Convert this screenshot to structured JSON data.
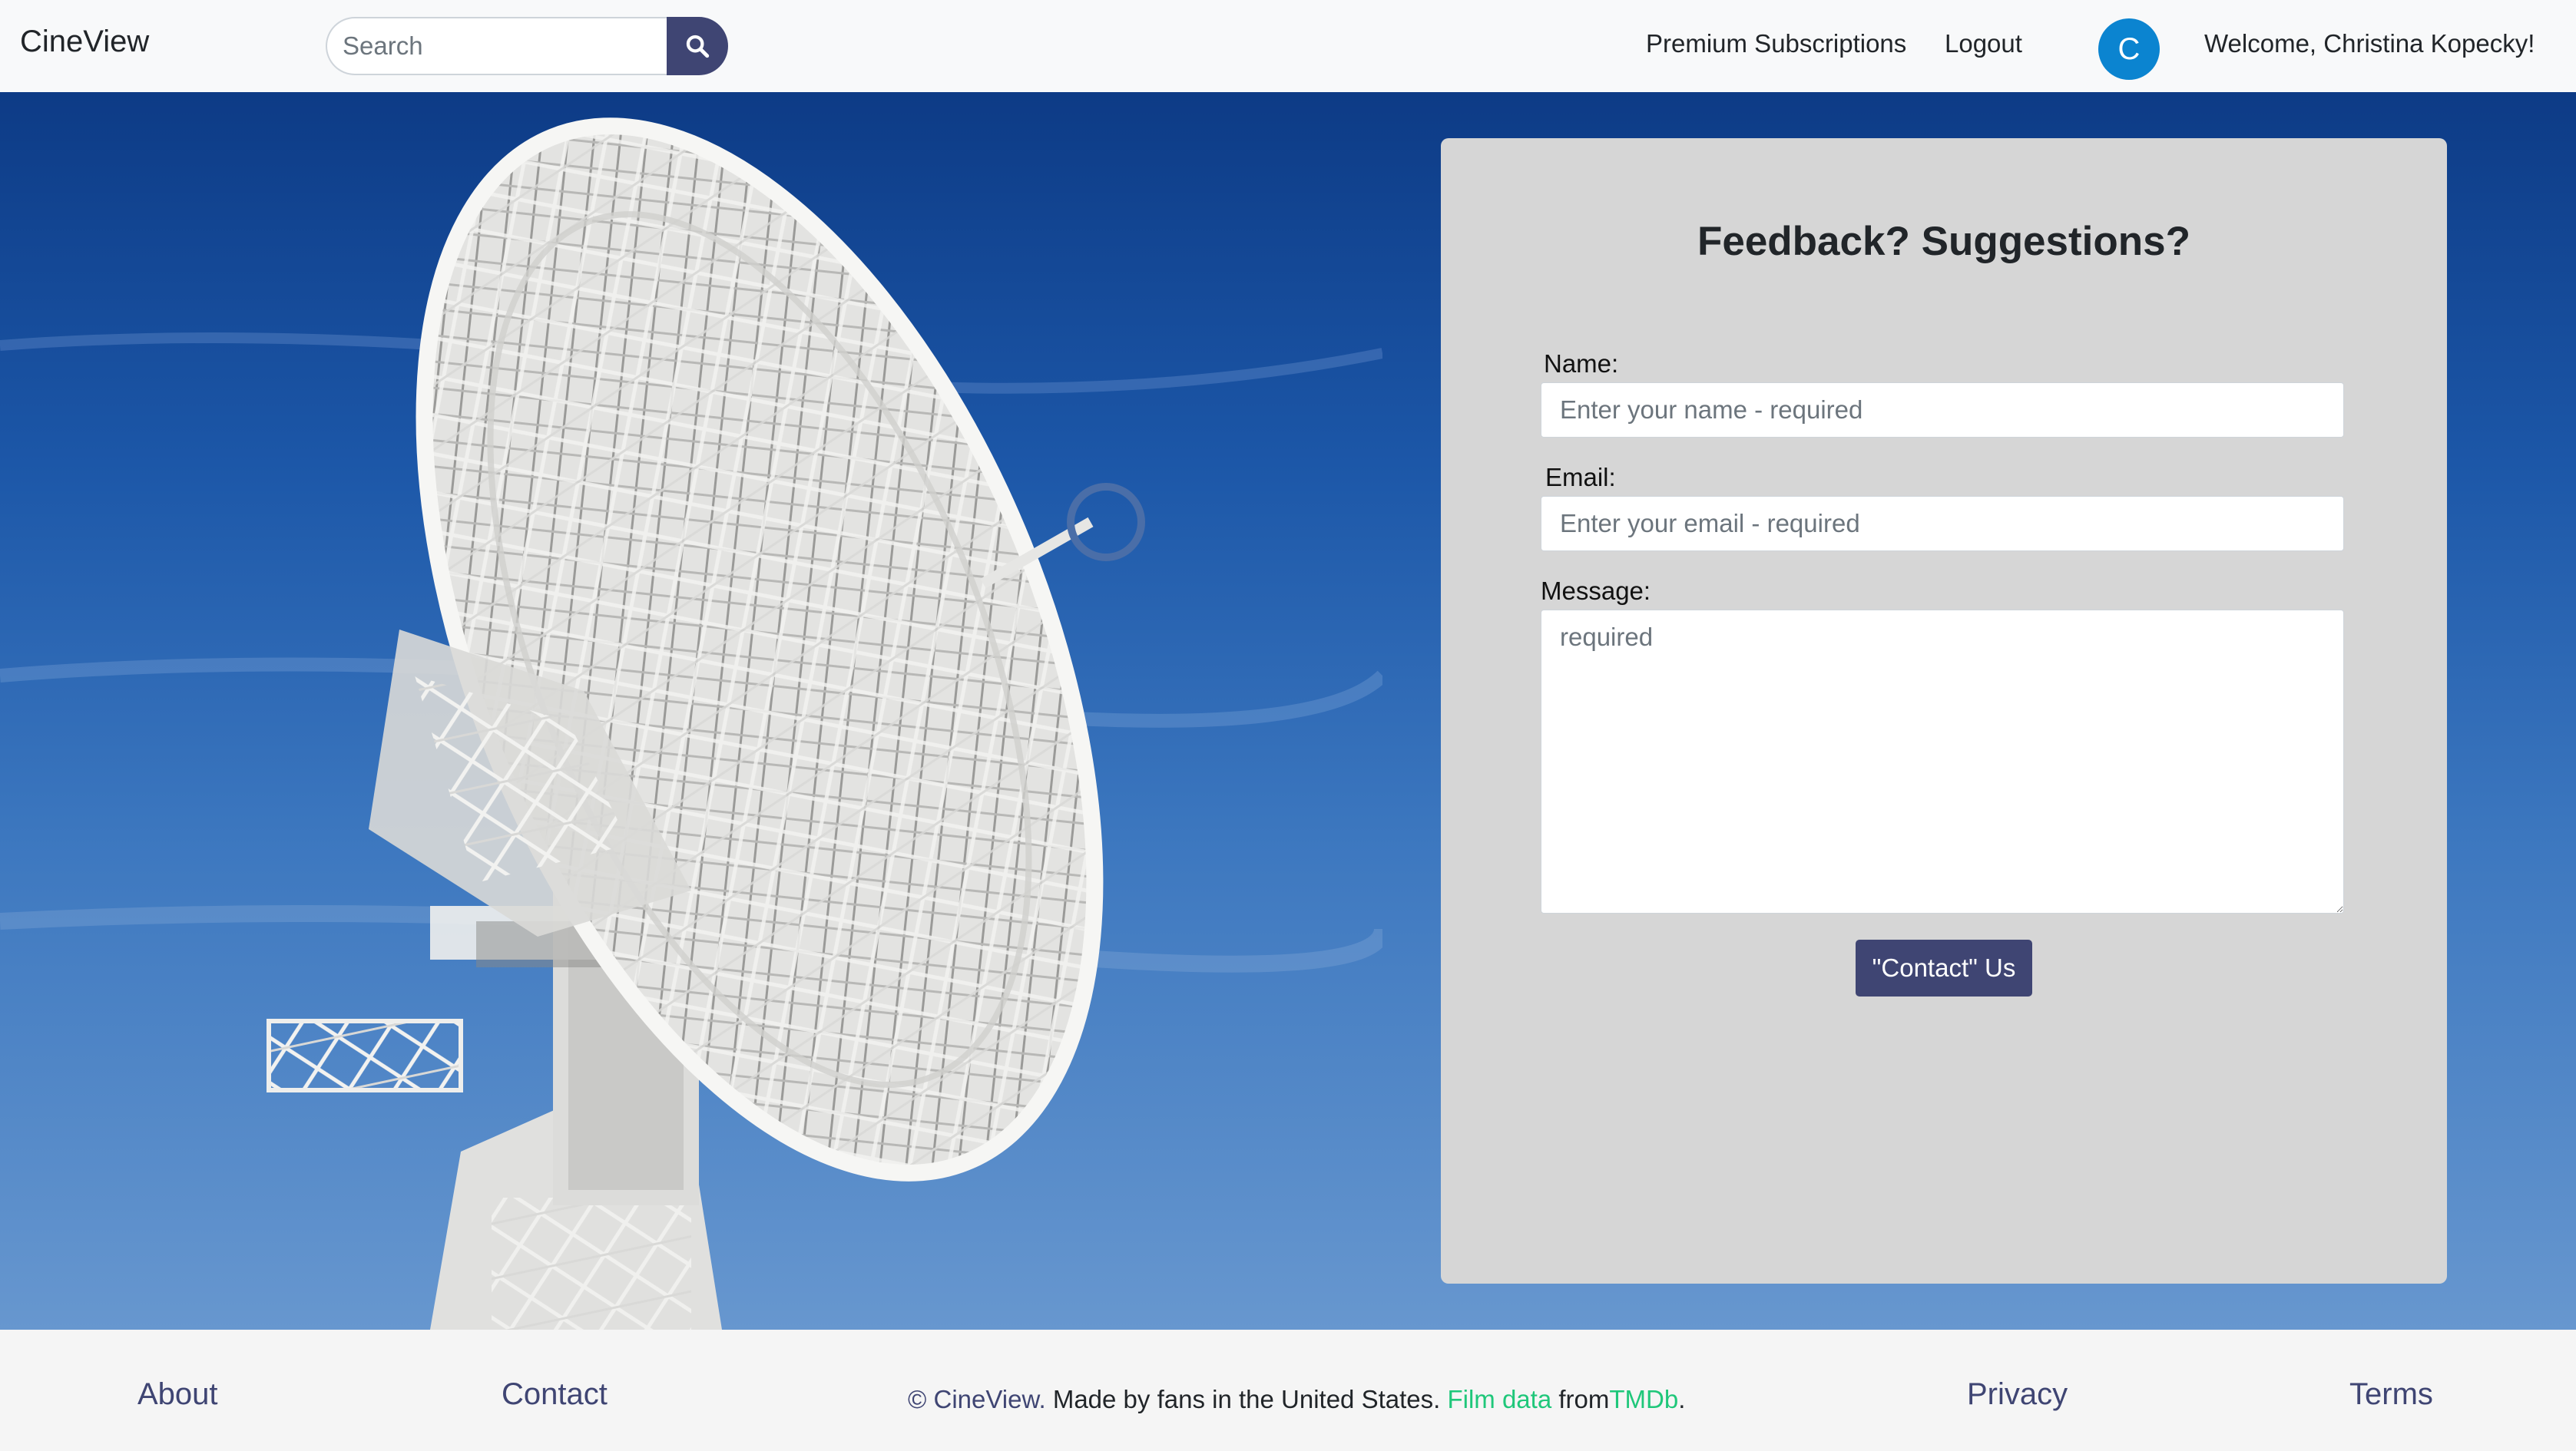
{
  "navbar": {
    "brand": "CineView",
    "search_placeholder": "Search",
    "search_icon": "search-icon",
    "links": {
      "premium": "Premium Subscriptions",
      "logout": "Logout"
    },
    "avatar_letter": "C",
    "avatar_color": "#0b84d0",
    "welcome": "Welcome, Christina Kopecky!"
  },
  "form": {
    "title": "Feedback? Suggestions?",
    "name_label": "Name:",
    "name_placeholder": "Enter your name - required",
    "email_label": "Email:",
    "email_placeholder": "Enter your email - required",
    "message_label": "Message:",
    "message_placeholder": "required",
    "submit_label": "\"Contact\" Us"
  },
  "footer": {
    "about": "About",
    "contact": "Contact",
    "copyright_symbol": "©",
    "copyright_brand": "CineView.",
    "copyright_text": "Made by fans in the United States.",
    "film_data": "Film data",
    "from": "from",
    "tmdb": "TMDb",
    "period": ".",
    "privacy": "Privacy",
    "terms": "Terms"
  },
  "colors": {
    "primary": "#3f4573",
    "accent_green": "#1fc77a",
    "sky": "#1c57a8"
  }
}
